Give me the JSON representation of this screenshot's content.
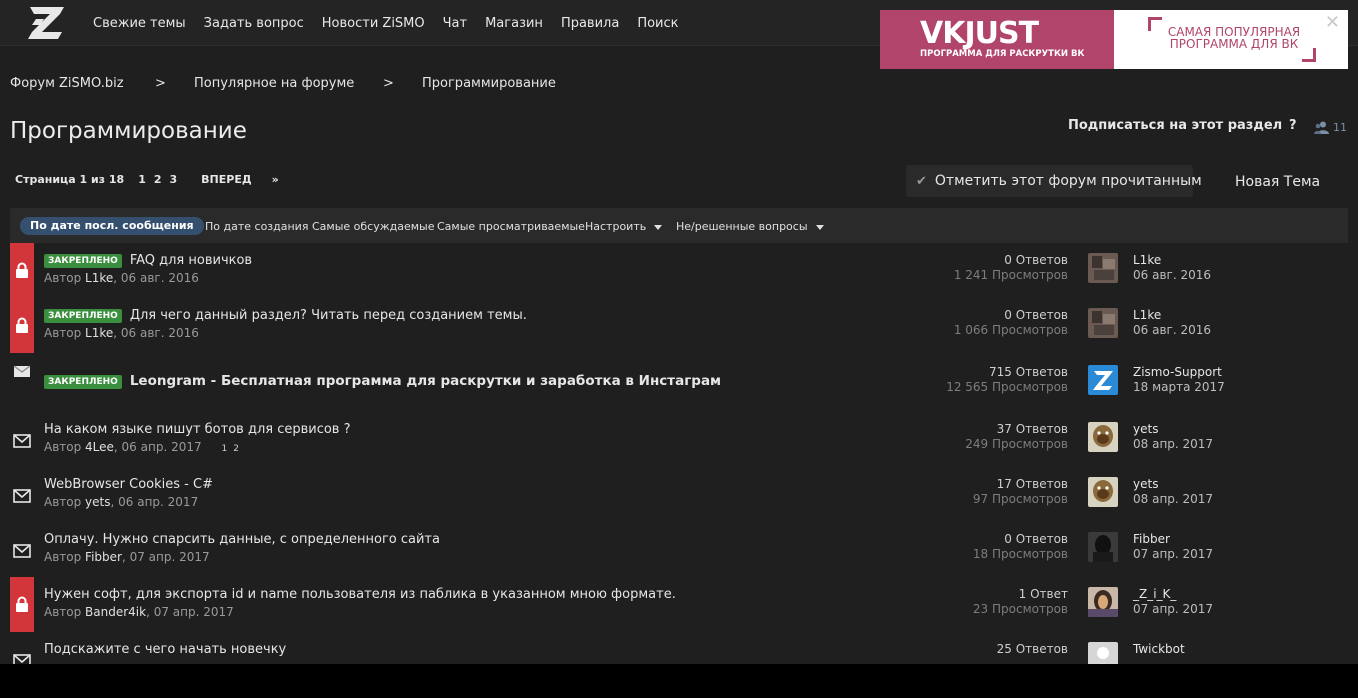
{
  "nav": {
    "items": [
      "Свежие темы",
      "Задать вопрос",
      "Новости ZiSMO",
      "Чат",
      "Магазин",
      "Правила",
      "Поиск"
    ]
  },
  "ad": {
    "brand": "VKJUST",
    "sub": "ПРОГРАММА ДЛЯ РАСКРУТКИ ВК",
    "text_line1": "САМАЯ ПОПУЛЯРНАЯ",
    "text_line2": "ПРОГРАММА ДЛЯ ВК",
    "close": "✕"
  },
  "breadcrumb": {
    "items": [
      "Форум ZiSMO.biz",
      "Популярное на форуме",
      "Программирование"
    ],
    "separator": ">"
  },
  "header": {
    "title": "Программирование",
    "subscribe": "Подписаться на этот раздел",
    "help": "?",
    "watchers": "11"
  },
  "pager": {
    "label": "Страница 1 из 18",
    "pages": [
      "1",
      "2",
      "3"
    ],
    "next": "ВПЕРЕД",
    "next_arrow": "»"
  },
  "actions": {
    "mark_read": "Отметить этот форум прочитанным",
    "new_thread": "Новая Тема"
  },
  "filters": {
    "active": "По дате посл. сообщения",
    "items": [
      "По дате создания",
      "Самые обсуждаемые",
      "Самые просматриваемые",
      "Настроить",
      "Не/решенные вопросы"
    ]
  },
  "colors": {
    "background": "#1f1f1f",
    "locked_bar": "#d3363a",
    "pinned_badge": "#3a8f3e",
    "active_filter": "#35506f",
    "ad_pink": "#b0446b"
  },
  "threads": [
    {
      "icon": "lock-icon",
      "badge": "ЗАКРЕПЛЕНО",
      "title": "FAQ для новичков",
      "author_prefix": "Автор ",
      "author": "L1ke",
      "date": ", 06 авг. 2016",
      "replies": "0 Ответов",
      "views": "1 241 Просмотров",
      "last_user": "L1ke",
      "last_date": "06 авг. 2016"
    },
    {
      "icon": "lock-icon",
      "badge": "ЗАКРЕПЛЕНО",
      "title": "Для чего данный раздел? Читать перед созданием темы.",
      "author_prefix": "Автор ",
      "author": "L1ke",
      "date": ", 06 авг. 2016",
      "replies": "0 Ответов",
      "views": "1 066 Просмотров",
      "last_user": "L1ke",
      "last_date": "06 авг. 2016"
    },
    {
      "icon": "mail-icon",
      "badge": "ЗАКРЕПЛЕНО",
      "title": "Leongram - Бесплатная программа для раскрутки и заработка в Инстаграм",
      "replies": "715 Ответов",
      "views": "12 565 Просмотров",
      "last_user": "Zismo-Support",
      "last_date": "18 марта 2017"
    },
    {
      "icon": "mail-icon",
      "title": "На каком языке пишут ботов для сервисов ?",
      "author_prefix": "Автор ",
      "author": "4Lee",
      "date": ", 06 апр. 2017",
      "pages": [
        "1",
        "2"
      ],
      "replies": "37 Ответов",
      "views": "249 Просмотров",
      "last_user": "yets",
      "last_date": "08 апр. 2017"
    },
    {
      "icon": "mail-icon",
      "title": "WebBrowser Cookies - C#",
      "author_prefix": "Автор ",
      "author": "yets",
      "date": ", 06 апр. 2017",
      "replies": "17 Ответов",
      "views": "97 Просмотров",
      "last_user": "yets",
      "last_date": "08 апр. 2017"
    },
    {
      "icon": "mail-icon",
      "title": "Оплачу. Нужно спарсить данные, с определенного сайта",
      "author_prefix": "Автор ",
      "author": "Fibber",
      "date": ", 07 апр. 2017",
      "replies": "0 Ответов",
      "views": "18 Просмотров",
      "last_user": "Fibber",
      "last_date": "07 апр. 2017"
    },
    {
      "icon": "lock-icon",
      "title": "Нужен софт, для экспорта id и name пользователя из паблика в указанном мною формате.",
      "author_prefix": "Автор ",
      "author": "Bander4ik",
      "date": ", 07 апр. 2017",
      "replies": "1 Ответ",
      "views": "23 Просмотров",
      "last_user": "_Z_i_K_",
      "last_date": "07 апр. 2017"
    },
    {
      "icon": "mail-icon",
      "title": "Подскажите с чего начать новечку",
      "replies": "25 Ответов",
      "last_user": "Twickbot"
    }
  ]
}
